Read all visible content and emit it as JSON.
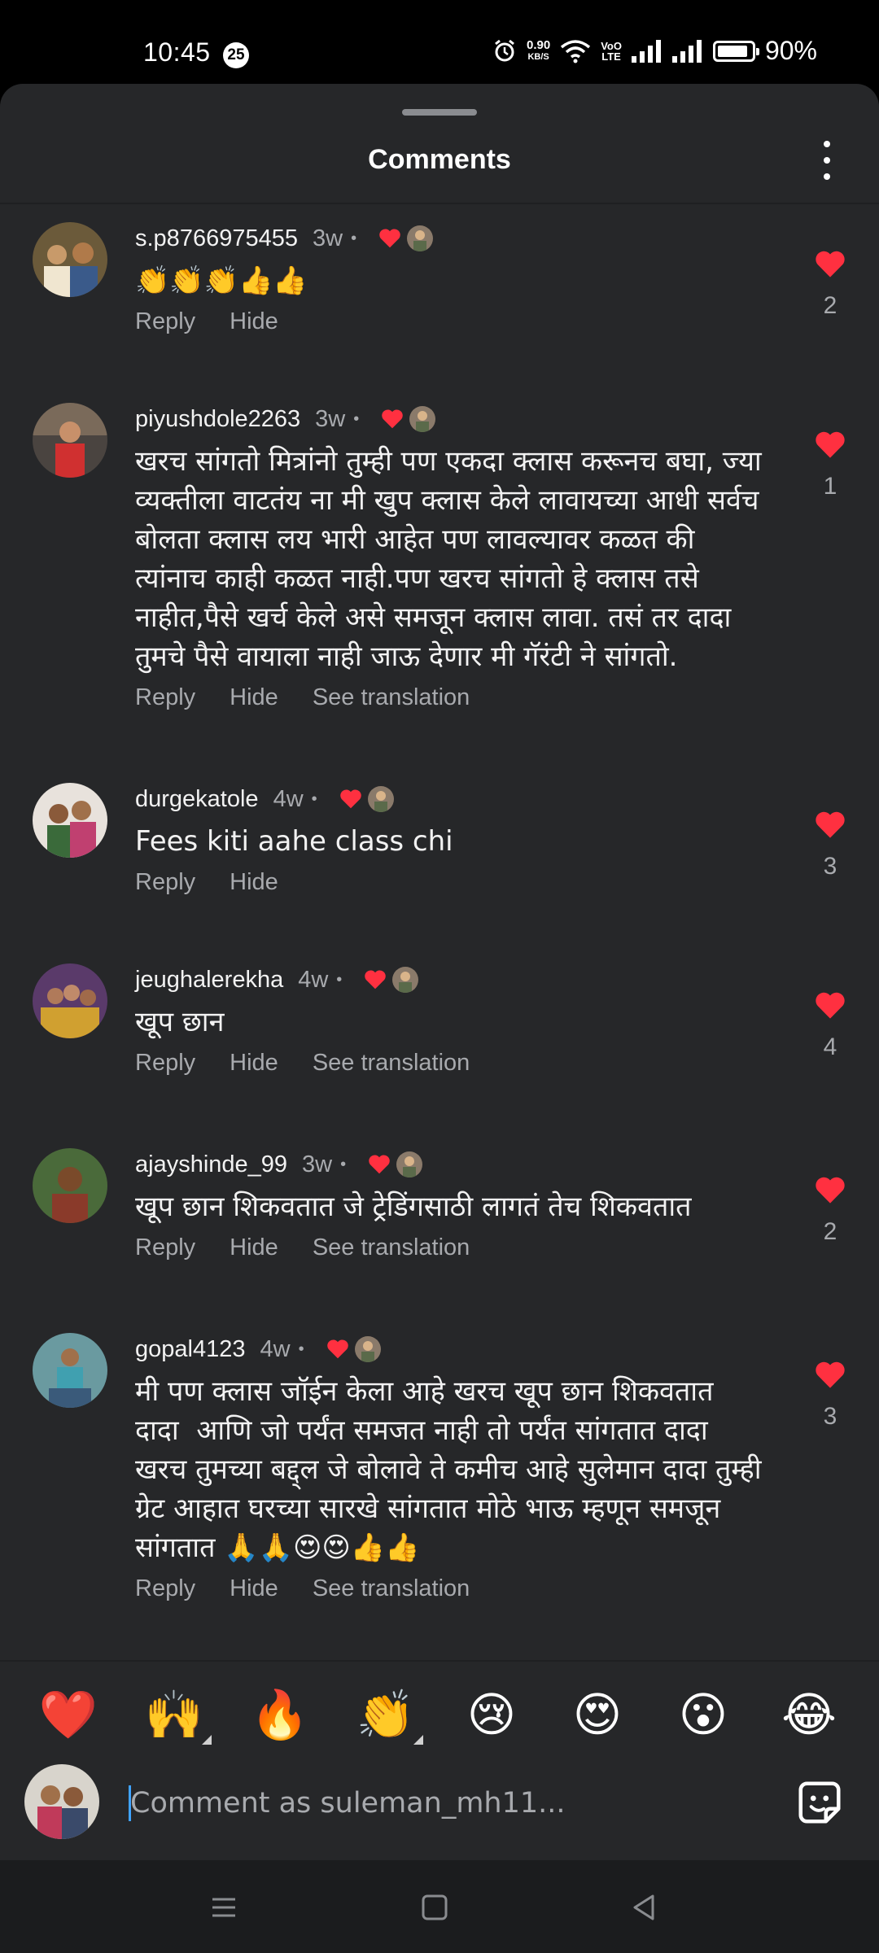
{
  "status_bar": {
    "time": "10:45",
    "notification_badge": "25",
    "net_speed_value": "0.90",
    "net_speed_unit": "KB/S",
    "volte_top": "VoO",
    "volte_bottom": "LTE",
    "battery": "90%",
    "battery_level": 0.9
  },
  "sheet": {
    "title": "Comments"
  },
  "comments": [
    {
      "username": "s.p8766975455",
      "time": "3w",
      "dot": "•",
      "text": "👏👏👏👍👍",
      "actions": [
        "Reply",
        "Hide"
      ],
      "likes": "2"
    },
    {
      "username": "piyushdole2263",
      "time": "3w",
      "dot": "•",
      "text": "खरच सांगतो मित्रांनो तुम्ही पण एकदा क्लास करूनच बघा, ज्या व्यक्तीला वाटतंय ना मी खुप क्लास केले लावायच्या आधी सर्वच बोलता क्लास लय भारी आहेत पण लावल्यावर कळत की त्यांनाच काही कळत नाही.पण खरच सांगतो हे क्लास तसे नाहीत,पैसे खर्च केले असे समजून क्लास लावा. तसं तर दादा तुमचे पैसे वायाला नाही जाऊ देणार मी गॅरंटी ने सांगतो.",
      "actions": [
        "Reply",
        "Hide",
        "See translation"
      ],
      "likes": "1"
    },
    {
      "username": "durgekatole",
      "time": "4w",
      "dot": "•",
      "text": "Fees kiti aahe class chi",
      "actions": [
        "Reply",
        "Hide"
      ],
      "likes": "3"
    },
    {
      "username": "jeughalerekha",
      "time": "4w",
      "dot": "•",
      "text": "खूप छान",
      "actions": [
        "Reply",
        "Hide",
        "See translation"
      ],
      "likes": "4"
    },
    {
      "username": "ajayshinde_99",
      "time": "3w",
      "dot": "•",
      "text": "खूप छान शिकवतात जे ट्रेडिंगसाठी लागतं तेच शिकवतात",
      "actions": [
        "Reply",
        "Hide",
        "See translation"
      ],
      "likes": "2"
    },
    {
      "username": "gopal4123",
      "time": "4w",
      "dot": "•",
      "text": "मी पण क्लास जॉईन केला आहे खरच खूप छान शिकवतात दादा  आणि जो पर्यंत समजत नाही तो पर्यंत सांगतात दादा खरच तुमच्या बद्द्ल जे बोलावे ते कमीच आहे सुलेमान दादा तुम्ही ग्रेट आहात घरच्या सारखे सांगतात मोठे भाऊ म्हणून समजून सांगतात 🙏🙏😍😍👍👍",
      "actions": [
        "Reply",
        "Hide",
        "See translation"
      ],
      "likes": "3"
    }
  ],
  "emoji_bar": [
    "❤️",
    "🙌",
    "🔥",
    "👏",
    "😢",
    "😍",
    "😮",
    "😂"
  ],
  "composer": {
    "placeholder": "Comment as suleman_mh11..."
  },
  "colors": {
    "sheet_bg": "#262729",
    "like_red": "#ff3040",
    "muted_text": "#a8aaae",
    "caret_blue": "#3fa3ff"
  }
}
